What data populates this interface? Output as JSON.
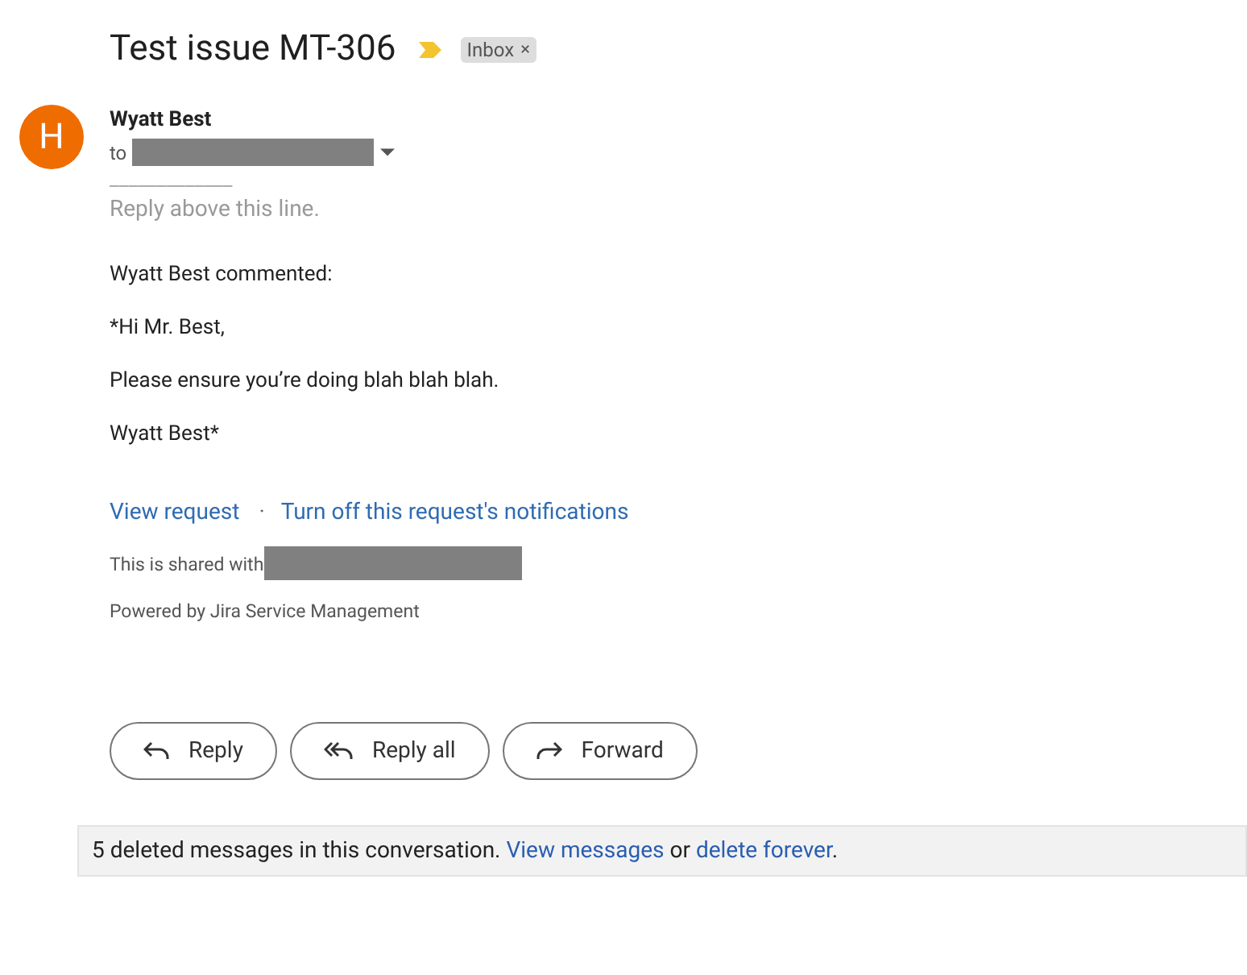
{
  "subject": "Test issue MT-306",
  "important": true,
  "label": {
    "text": "Inbox",
    "close": "×"
  },
  "sender": {
    "initial": "H",
    "name": "Wyatt Best",
    "to": "to"
  },
  "body": {
    "separator": "_____________",
    "reply_hint": "Reply above this line.",
    "paragraphs": [
      "Wyatt Best commented:",
      "*Hi Mr. Best,",
      "Please ensure you’re doing blah blah blah.",
      "Wyatt Best*"
    ],
    "links": [
      "View request",
      "Turn off this request's notifications"
    ],
    "link_separator": "·",
    "shared": "This is shared with",
    "powered": "Powered by Jira Service Management"
  },
  "actions": [
    {
      "kind": "reply",
      "label": "Reply"
    },
    {
      "kind": "reply_all",
      "label": "Reply all"
    },
    {
      "kind": "forward",
      "label": "Forward"
    }
  ],
  "deleted_bar": [
    {
      "kind": "text",
      "text": "5 deleted messages in this conversation. "
    },
    {
      "kind": "link",
      "text": "View messages"
    },
    {
      "kind": "text",
      "text": " or "
    },
    {
      "kind": "link",
      "text": "delete forever"
    },
    {
      "kind": "text",
      "text": "."
    }
  ]
}
